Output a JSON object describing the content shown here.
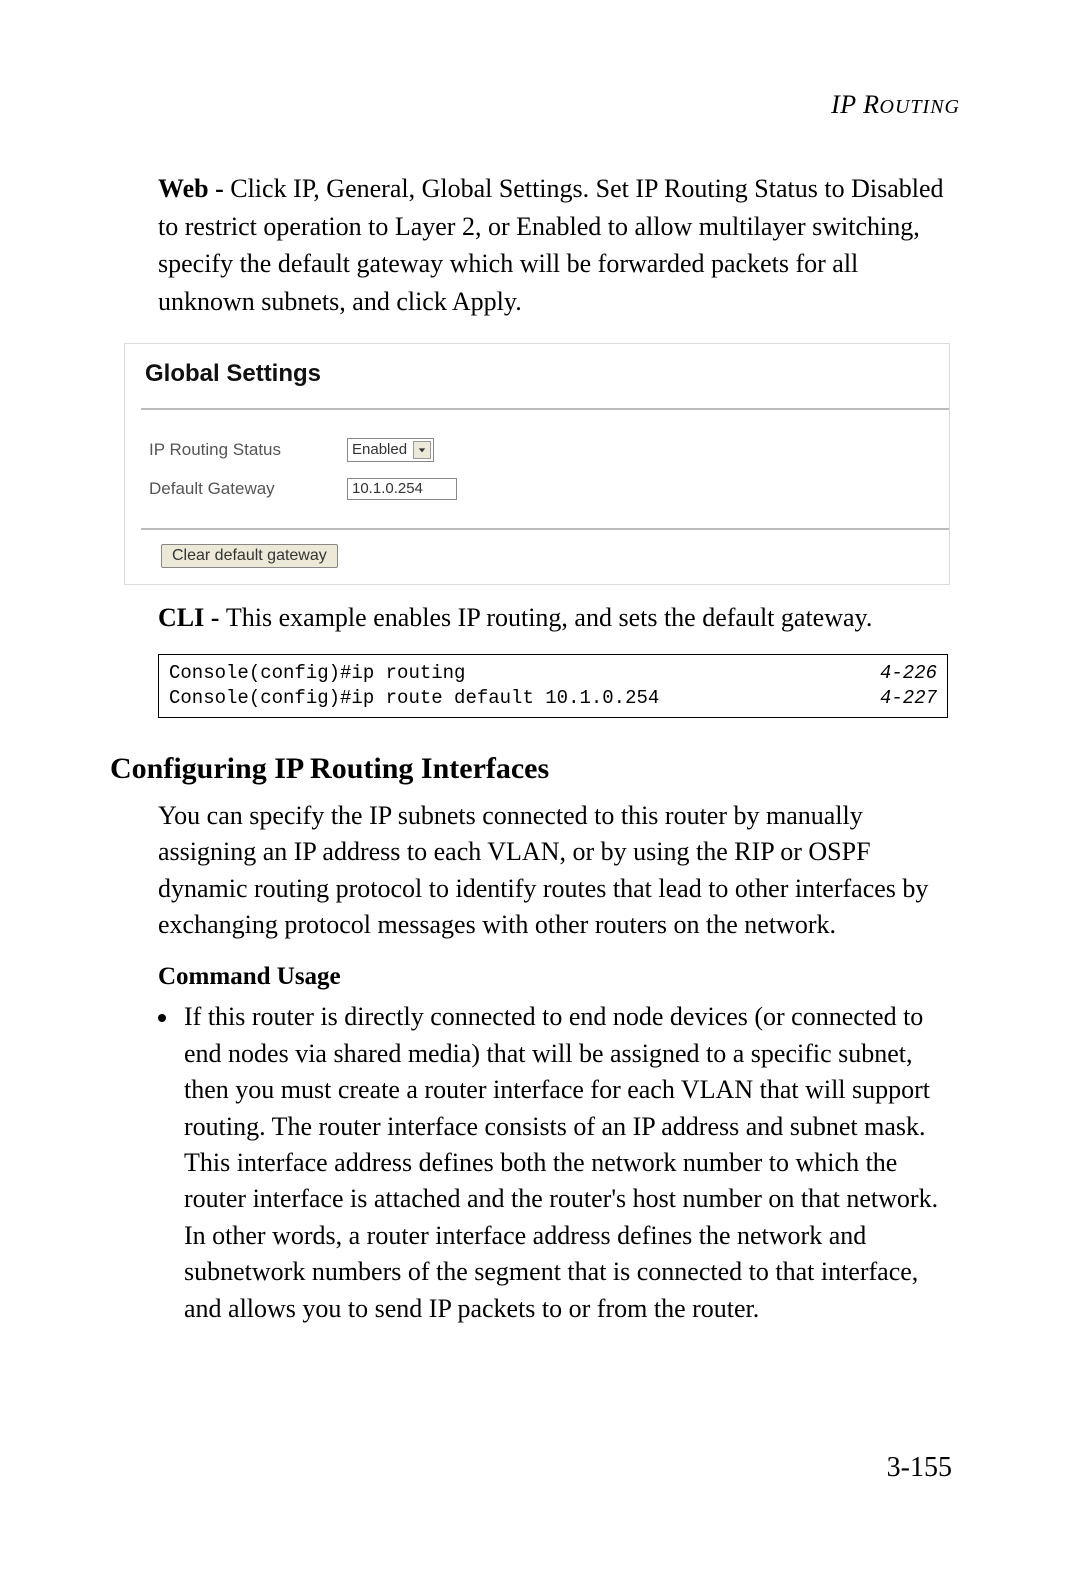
{
  "header": {
    "title_main": "IP R",
    "title_smallcaps": "OUTING"
  },
  "para_web_prefix": "Web - ",
  "para_web": "Click IP, General, Global Settings. Set IP Routing Status to Disabled to restrict operation to Layer 2, or Enabled to allow multilayer switching, specify the default gateway which will be forwarded packets for all unknown subnets, and click Apply.",
  "panel": {
    "title": "Global Settings",
    "row1_label": "IP Routing Status",
    "row1_value": "Enabled",
    "row2_label": "Default Gateway",
    "row2_value": "10.1.0.254",
    "button_label": "Clear default gateway"
  },
  "para_cli_prefix": "CLI - ",
  "para_cli": "This example enables IP routing, and sets the default gateway.",
  "code": {
    "line1_cmd": "Console(config)#ip routing",
    "line1_ref": "4-226",
    "line2_cmd": "Console(config)#ip route default 10.1.0.254",
    "line2_ref": "4-227"
  },
  "section_heading": "Configuring IP Routing Interfaces",
  "section_para": "You can specify the IP subnets connected to this router by manually assigning an IP address to each VLAN, or by using the RIP or OSPF dynamic routing protocol to identify routes that lead to other interfaces by exchanging protocol messages with other routers on the network.",
  "command_usage_heading": "Command Usage",
  "bullet1": "If this router is directly connected to end node devices (or connected to end nodes via shared media) that will be assigned to a specific subnet, then you must create a router interface for each VLAN that will support routing. The router interface consists of an IP address and subnet mask. This interface address defines both the network number to which the router interface is attached and the router's host number on that network. In other words, a router interface address defines the network and subnetwork numbers of the segment that is connected to that interface, and allows you to send IP packets to or from the router.",
  "page_number": "3-155"
}
